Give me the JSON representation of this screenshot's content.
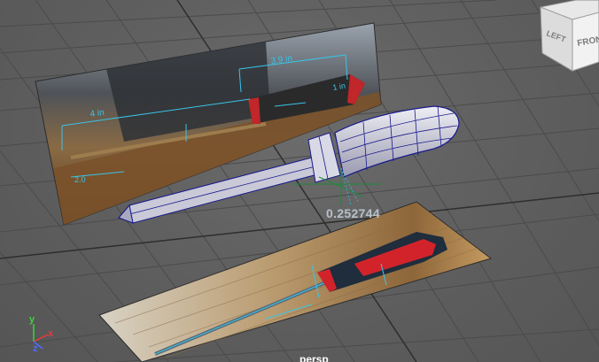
{
  "viewport": {
    "camera_name": "persp",
    "manipulator_readout": "0.252744"
  },
  "viewcube": {
    "left_face": "LEFT",
    "front_face": "FRONT"
  },
  "axis_gizmo": {
    "y": "y",
    "x": "x",
    "z": "z",
    "colors": {
      "x": "#e63b3b",
      "y": "#3cd23c",
      "z": "#4a6cff"
    }
  },
  "side_reference": {
    "annotation_top": "3.9 in",
    "annotation_left": "4 in",
    "annotation_handle": "1 in",
    "annotation_bottom": "2.0"
  },
  "colors": {
    "grid": "#4a4a4a",
    "grid_axis": "#2f2f2f",
    "wireframe": "#1a1a8c",
    "selection": "#3ac4e8",
    "pivot": "#1b6b2e"
  }
}
